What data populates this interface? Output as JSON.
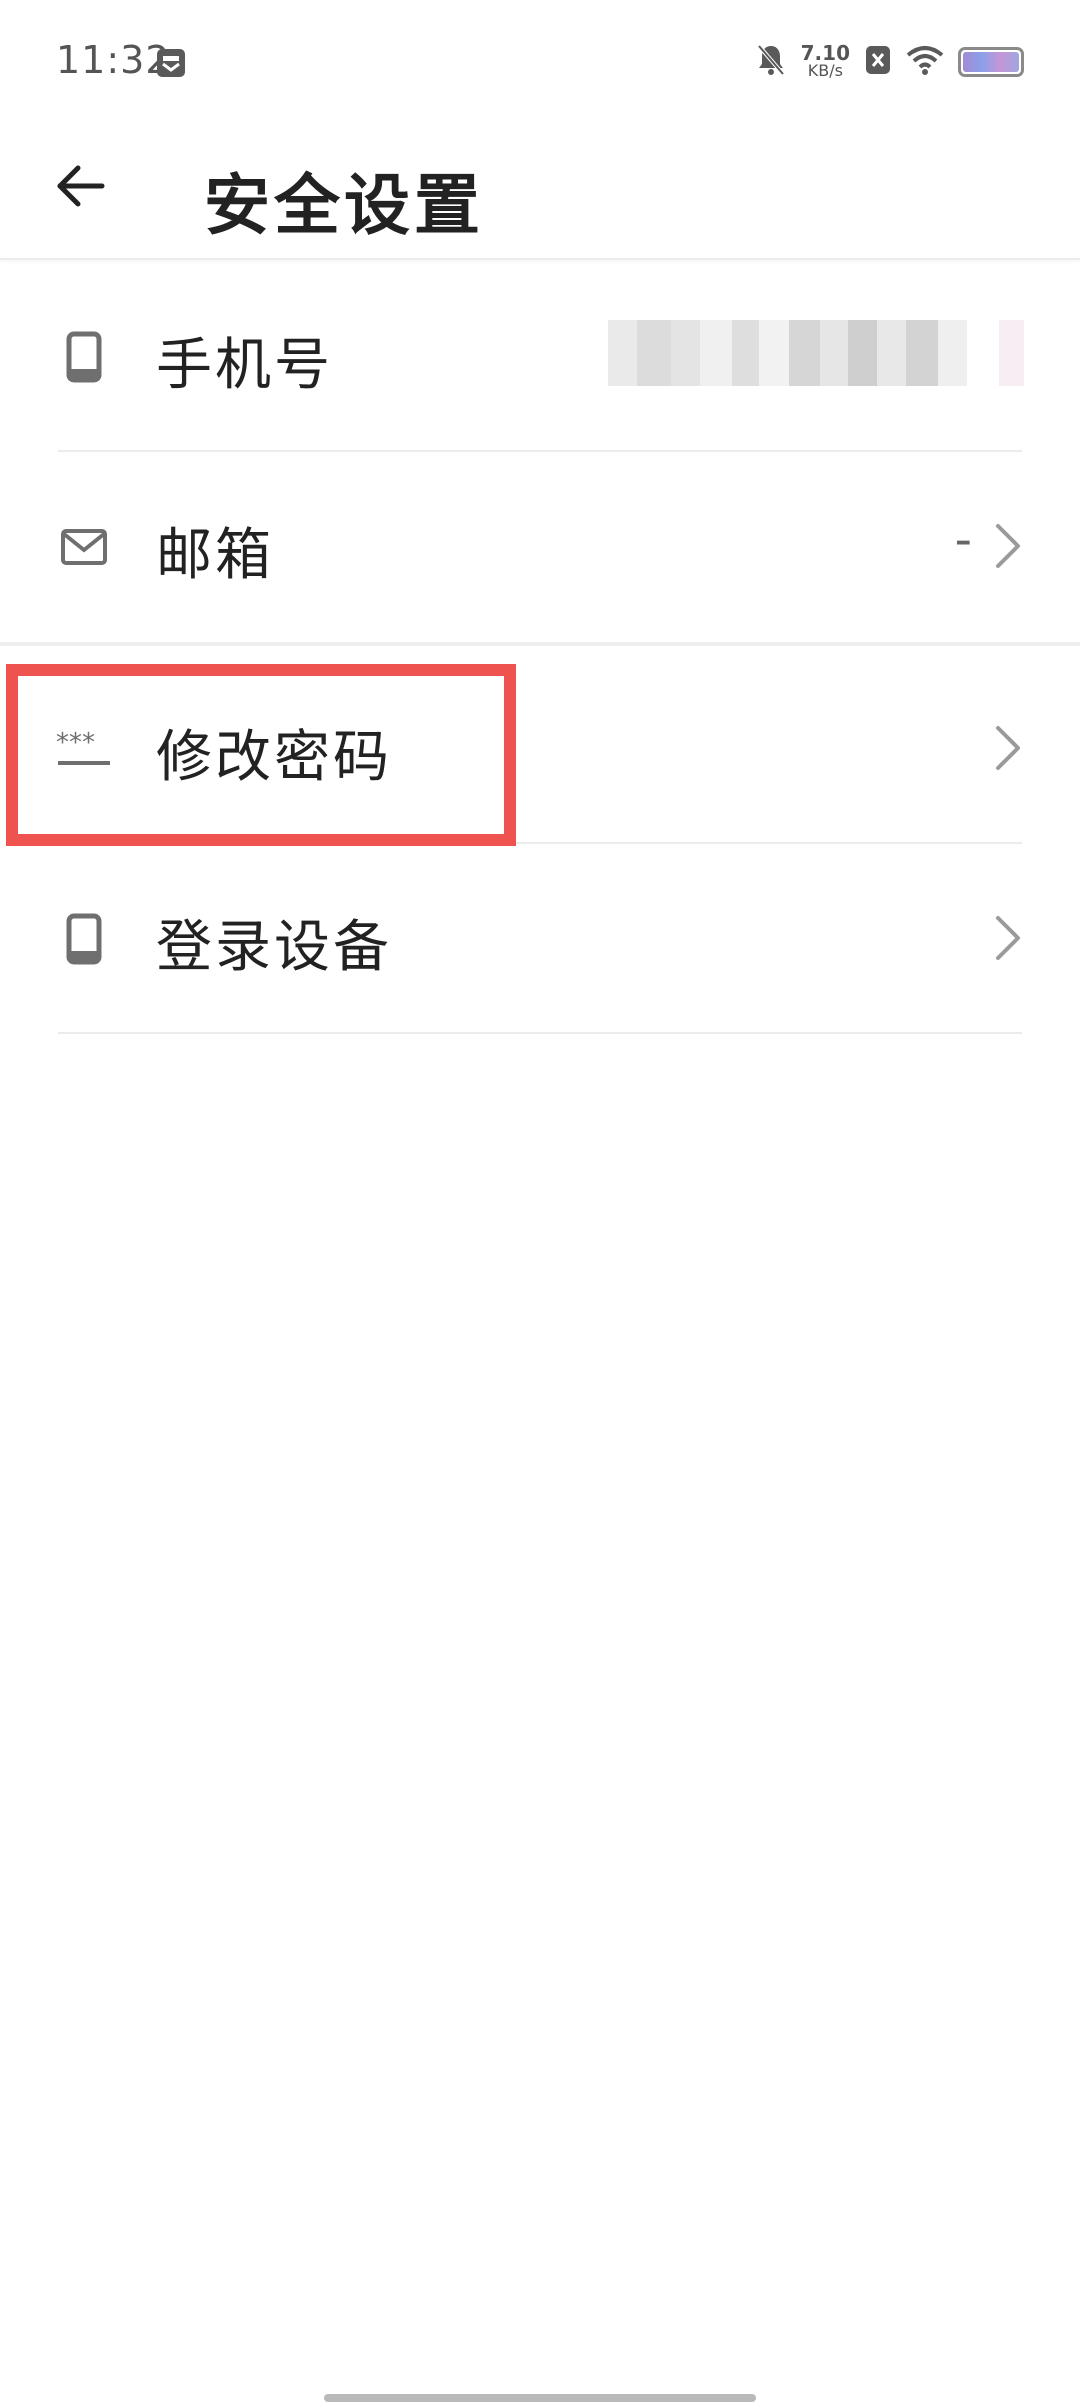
{
  "status_bar": {
    "time": "11:32",
    "net_speed_value": "7.10",
    "net_speed_unit": "KB/s",
    "battery_level": 1.0
  },
  "header": {
    "title": "安全设置"
  },
  "rows": [
    {
      "label": "手机号",
      "value": ""
    },
    {
      "label": "邮箱",
      "value": "-"
    },
    {
      "label": "修改密码",
      "value": ""
    },
    {
      "label": "登录设备",
      "value": ""
    }
  ],
  "colors": {
    "highlight": "#ee5350",
    "divider": "#ececec",
    "text": "#222222",
    "icon": "#6f6f6f"
  }
}
